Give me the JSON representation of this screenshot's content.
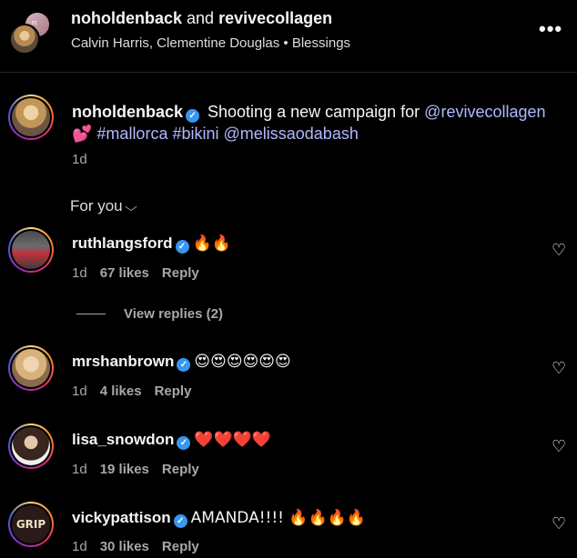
{
  "header": {
    "user1": "noholdenback",
    "and": " and ",
    "user2": "revivecollagen",
    "subtitle": "Calvin Harris, Clementine Douglas • Blessings",
    "more_icon": "more-horizontal-icon"
  },
  "caption": {
    "username": "noholdenback",
    "text_1": " Shooting a new campaign for ",
    "mention_1": "@revivecollagen",
    "emoji": "💕",
    "hashtags": " #mallorca #bikini ",
    "mention_2": "@melissaodabash",
    "time": "1d"
  },
  "sort": {
    "label": "For you"
  },
  "comments": [
    {
      "username": "ruthlangsford",
      "text": "🔥🔥",
      "time": "1d",
      "likes": "67 likes",
      "reply": "Reply",
      "view_replies": "View replies (2)"
    },
    {
      "username": "mrshanbrown",
      "text": "😍😍😍😍😍😍",
      "time": "1d",
      "likes": "4 likes",
      "reply": "Reply"
    },
    {
      "username": "lisa_snowdon",
      "text": "❤️❤️❤️❤️",
      "time": "1d",
      "likes": "19 likes",
      "reply": "Reply"
    },
    {
      "username": "vickypattison",
      "text": "AMANDA!!!! 🔥🔥🔥🔥",
      "time": "1d",
      "likes": "30 likes",
      "reply": "Reply",
      "avatar_text": "GRIP"
    }
  ],
  "colors": {
    "verified": "#3897f0",
    "link": "#b0b8ff",
    "background": "#000000"
  }
}
